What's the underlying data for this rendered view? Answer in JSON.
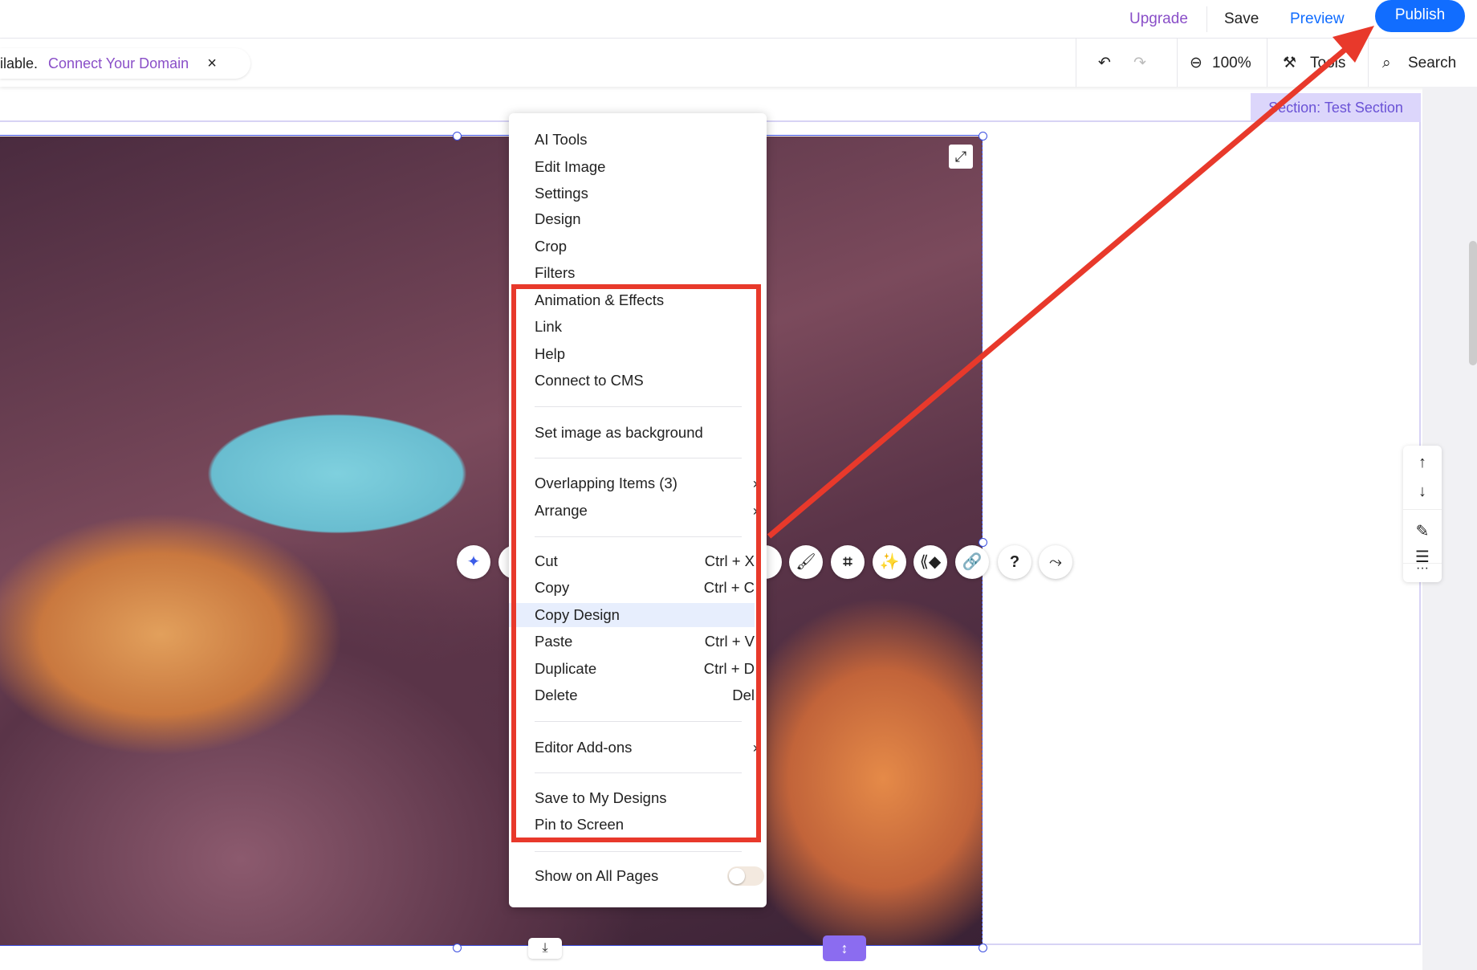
{
  "topbar": {
    "upgrade": "Upgrade",
    "save": "Save",
    "preview": "Preview",
    "publish": "Publish"
  },
  "notice": {
    "text": "ilable.",
    "link": "Connect Your Domain",
    "close": "×"
  },
  "toolbar": {
    "zoom": "100%",
    "tools": "Tools",
    "search": "Search"
  },
  "section_label": "Section: Test Section",
  "context_menu": {
    "items": [
      {
        "label": "AI Tools"
      },
      {
        "label": "Edit Image"
      },
      {
        "label": "Settings"
      },
      {
        "label": "Design"
      },
      {
        "label": "Crop"
      },
      {
        "label": "Filters"
      },
      {
        "label": "Animation & Effects"
      },
      {
        "label": "Link"
      },
      {
        "label": "Help"
      },
      {
        "label": "Connect to CMS"
      },
      {
        "label": "Set image as background"
      },
      {
        "label": "Overlapping Items (3)",
        "submenu": "›"
      },
      {
        "label": "Arrange",
        "submenu": "›"
      },
      {
        "label": "Cut",
        "shortcut": "Ctrl + X"
      },
      {
        "label": "Copy",
        "shortcut": "Ctrl + C"
      },
      {
        "label": "Copy Design"
      },
      {
        "label": "Paste",
        "shortcut": "Ctrl + V"
      },
      {
        "label": "Duplicate",
        "shortcut": "Ctrl + D"
      },
      {
        "label": "Delete",
        "shortcut": "Del"
      },
      {
        "label": "Editor Add-ons",
        "submenu": "›"
      },
      {
        "label": "Save to My Designs"
      },
      {
        "label": "Pin to Screen"
      },
      {
        "label": "Show on All Pages",
        "toggle": false
      }
    ]
  },
  "floating_toolbar": [
    "ai-sparkle-icon",
    "paint-brush-icon",
    "crop-icon",
    "magic-wand-icon",
    "animation-icon",
    "link-icon",
    "help-icon",
    "connect-icon"
  ],
  "right_toolbar": {
    "more": "···"
  },
  "colors": {
    "accent": "#116dff",
    "annotation": "#e8392b",
    "section": "#6a52d6"
  }
}
